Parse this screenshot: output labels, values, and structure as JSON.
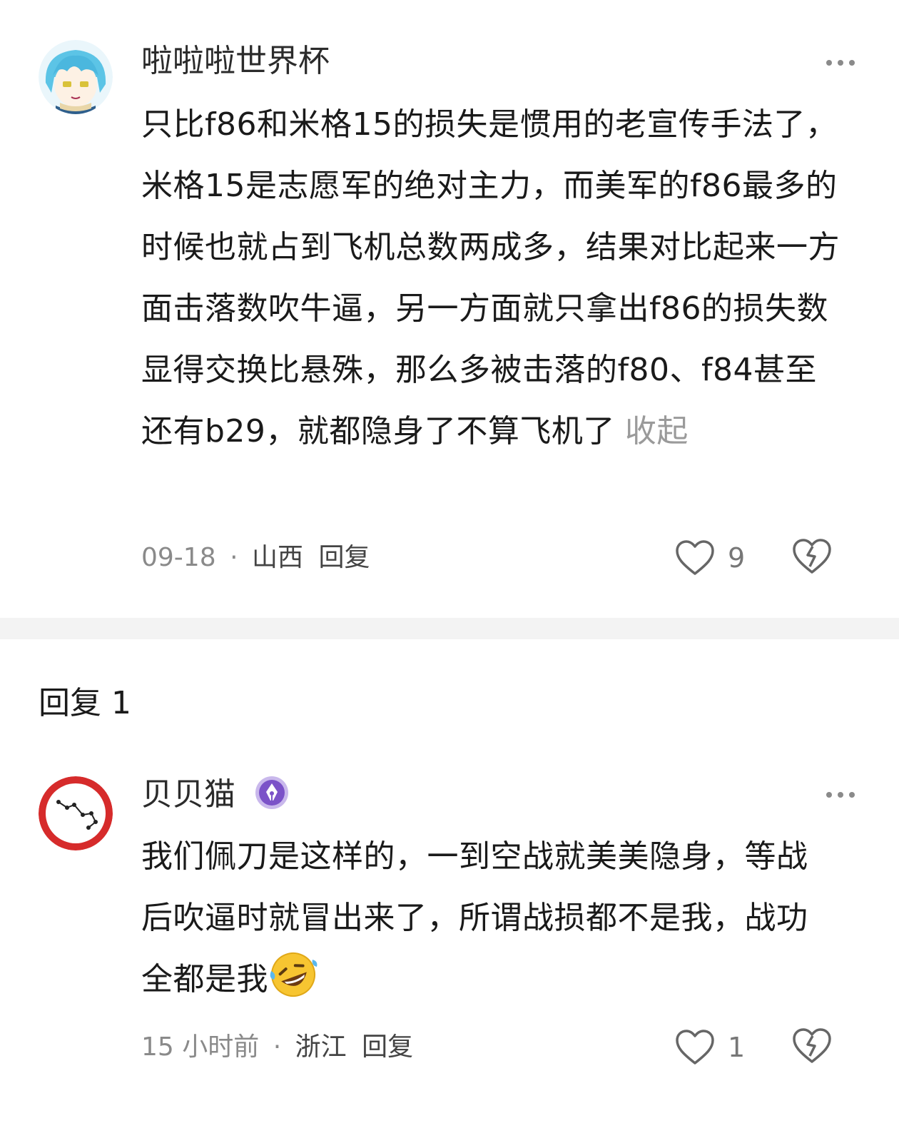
{
  "comment_main": {
    "username": "啦啦啦世界杯",
    "text": "只比f86和米格15的损失是惯用的老宣传手法了，米格15是志愿军的绝对主力，而美军的f86最多的时候也就占到飞机总数两成多，结果对比起来一方面击落数吹牛逼，另一方面就只拿出f86的损失数显得交换比悬殊，那么多被击落的f80、f84甚至还有b29，就都隐身了不算飞机了",
    "collapse_label": "收起",
    "date": "09-18",
    "separator": "·",
    "location": "山西",
    "reply_label": "回复",
    "likes": "9",
    "avatar_icon": "anime-girl-avatar",
    "more_icon": "more-dots-icon"
  },
  "replies_header": "回复 1",
  "comment_reply": {
    "username": "贝贝猫",
    "badge_icon": "pen-badge-icon",
    "text": "我们佩刀是这样的，一到空战就美美隐身，等战后吹逼时就冒出来了，所谓战损都不是我，战功全都是我",
    "emoji": "rolling-laughing-emoji",
    "time": "15 小时前",
    "separator": "·",
    "location": "浙江",
    "reply_label": "回复",
    "likes": "1",
    "avatar_icon": "constellation-avatar"
  },
  "colors": {
    "text_primary": "#1a1a1a",
    "text_secondary": "#8a8a8a",
    "divider": "#f3f3f3",
    "badge_purple": "#7b52c8",
    "avatar_red": "#d62b2b"
  }
}
